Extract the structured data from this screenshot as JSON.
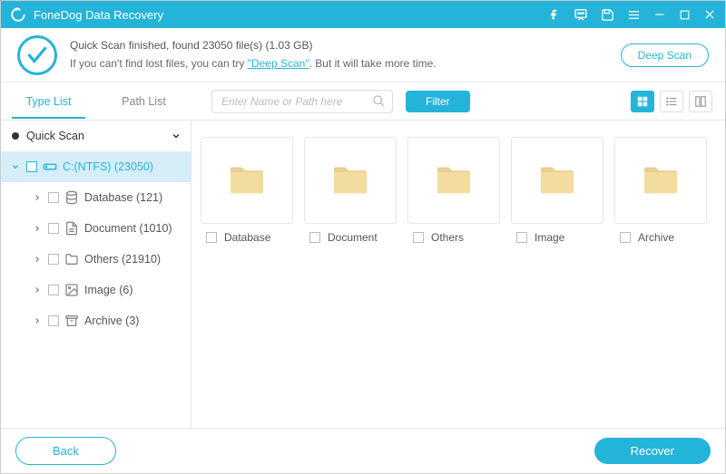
{
  "titlebar": {
    "title": "FoneDog Data Recovery"
  },
  "banner": {
    "line1": "Quick Scan finished, found 23050 file(s) (1.03 GB)",
    "line2_pre": "If you can't find lost files, you can try ",
    "line2_link": "\"Deep Scan\"",
    "line2_post": ". But it will take more time.",
    "deepscan_btn": "Deep Scan"
  },
  "tabs": {
    "type_list": "Type List",
    "path_list": "Path List"
  },
  "search": {
    "placeholder": "Enter Name or Path here"
  },
  "filter_btn": "Filter",
  "tree": {
    "root": "Quick Scan",
    "drive": "C:(NTFS) (23050)",
    "children": [
      {
        "label": "Database (121)",
        "icon": "database"
      },
      {
        "label": "Document (1010)",
        "icon": "document"
      },
      {
        "label": "Others (21910)",
        "icon": "folder"
      },
      {
        "label": "Image (6)",
        "icon": "image"
      },
      {
        "label": "Archive (3)",
        "icon": "archive"
      }
    ]
  },
  "cards": [
    {
      "label": "Database"
    },
    {
      "label": "Document"
    },
    {
      "label": "Others"
    },
    {
      "label": "Image"
    },
    {
      "label": "Archive"
    }
  ],
  "footer": {
    "back": "Back",
    "recover": "Recover"
  }
}
